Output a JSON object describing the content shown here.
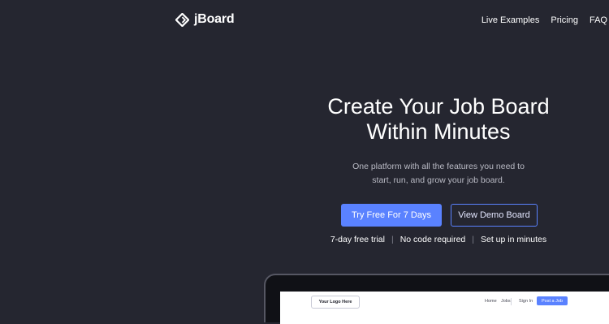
{
  "brand": {
    "name": "jBoard"
  },
  "nav": {
    "items": [
      {
        "label": "Live Examples"
      },
      {
        "label": "Pricing"
      },
      {
        "label": "FAQ"
      }
    ]
  },
  "hero": {
    "title_line1": "Create Your Job Board",
    "title_line2": "Within Minutes",
    "subtitle_line1": "One platform with all the features you need to",
    "subtitle_line2": "start, run, and grow your job board.",
    "primary_button": "Try Free For 7 Days",
    "secondary_button": "View Demo Board",
    "features": [
      "7-day free trial",
      "No code required",
      "Set up in minutes"
    ],
    "separator": "|"
  },
  "preview": {
    "logo_label": "Your Logo Here",
    "nav_items": [
      "Home",
      "Jobs",
      "Sign In"
    ],
    "post_button": "Post a Job"
  },
  "colors": {
    "background": "#252630",
    "accent": "#5a82ff",
    "muted_text": "#b9bac4"
  }
}
